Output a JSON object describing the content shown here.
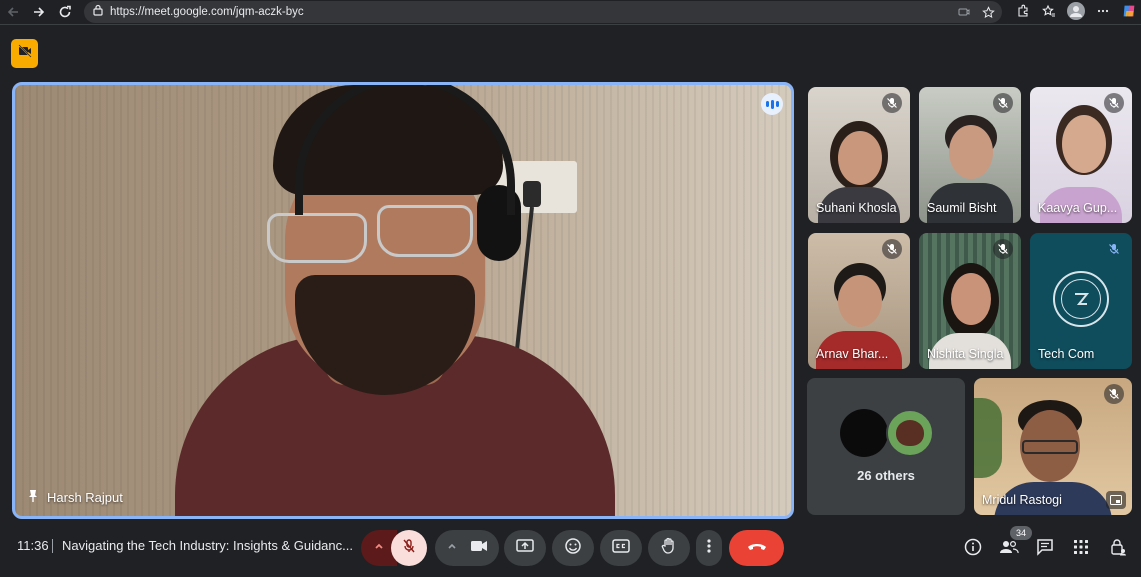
{
  "browser": {
    "url": "https://meet.google.com/jqm-aczk-byc",
    "icons": [
      "back-icon",
      "forward-icon",
      "reload-icon",
      "site-info-icon",
      "cast-icon",
      "star-icon",
      "extensions-icon",
      "favorites-icon",
      "profile-icon",
      "menu-icon",
      "copilot-icon"
    ]
  },
  "meeting": {
    "time": "11:36",
    "title": "Navigating the Tech Industry: Insights & Guidanc...",
    "participant_count": "34"
  },
  "main_speaker": {
    "name": "Harsh Rajput"
  },
  "participants": [
    {
      "name": "Suhani Khosla",
      "muted": true
    },
    {
      "name": "Saumil Bisht",
      "muted": true
    },
    {
      "name": "Kaavya Gup...",
      "muted": true
    },
    {
      "name": "Arnav Bhar...",
      "muted": true
    },
    {
      "name": "Nishita Singla",
      "muted": true
    },
    {
      "name": "Tech Com",
      "muted": true
    }
  ],
  "others": {
    "label": "26 others"
  },
  "self_tile": {
    "name": "Mridul Rastogi",
    "muted": true
  },
  "colors": {
    "background": "#202124",
    "accent_blue": "#8ab4f8",
    "end_call_red": "#ea4335",
    "mic_off_pink": "#f9dedc",
    "badge_yellow": "#f9ab00"
  }
}
